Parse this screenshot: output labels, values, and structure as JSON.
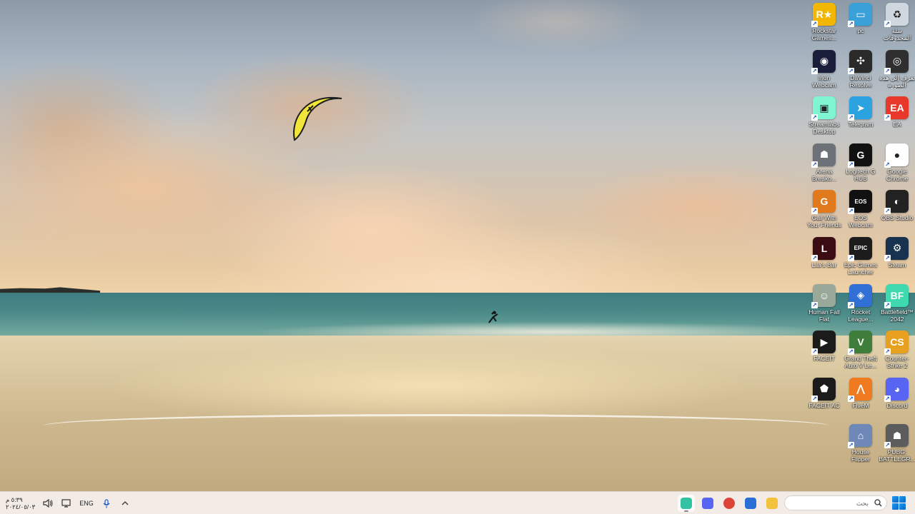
{
  "desktop_icons": [
    {
      "label": "Rockstar Games...",
      "icon": "rockstar-games-icon",
      "color": "#f2b705",
      "glyph": "R★"
    },
    {
      "label": "pc",
      "icon": "this-pc-icon",
      "color": "#3aa0d8",
      "glyph": "▭"
    },
    {
      "label": "سلة المحذوفات",
      "icon": "recycle-bin-icon",
      "color": "#cfd8de",
      "glyph": "♻"
    },
    {
      "label": "Iriun Webcam",
      "icon": "iriun-webcam-icon",
      "color": "#1b1e3a",
      "glyph": "◉"
    },
    {
      "label": "DaVinci Resolve",
      "icon": "davinci-resolve-icon",
      "color": "#2a2a2a",
      "glyph": "✣"
    },
    {
      "label": "تعرف إلى هذه الصورة",
      "icon": "learn-about-picture-icon",
      "color": "#2f2f2f",
      "glyph": "◎"
    },
    {
      "label": "Streamlabs Desktop",
      "icon": "streamlabs-icon",
      "color": "#80f5d2",
      "glyph": "▣"
    },
    {
      "label": "Telegram",
      "icon": "telegram-icon",
      "color": "#2aa3e0",
      "glyph": "➤"
    },
    {
      "label": "EA",
      "icon": "ea-icon",
      "color": "#e8382c",
      "glyph": "EA"
    },
    {
      "label": "Arena Breako...",
      "icon": "arena-breakout-icon",
      "color": "#6d7278",
      "glyph": "☗"
    },
    {
      "label": "Logitech G HUB",
      "icon": "logitech-g-hub-icon",
      "color": "#111111",
      "glyph": "G"
    },
    {
      "label": "Google Chrome",
      "icon": "chrome-icon",
      "color": "#ffffff",
      "glyph": "●"
    },
    {
      "label": "Gall With Your Friends",
      "icon": "golf-with-friends-icon",
      "color": "#e07a1c",
      "glyph": "G"
    },
    {
      "label": "EOS Webcam Utility Pro",
      "icon": "eos-webcam-icon",
      "color": "#111111",
      "glyph": "EOS"
    },
    {
      "label": "OBS Studio",
      "icon": "obs-studio-icon",
      "color": "#222222",
      "glyph": "◐"
    },
    {
      "label": "Lila's Bar",
      "icon": "lilas-bar-icon",
      "color": "#3b0d12",
      "glyph": "L"
    },
    {
      "label": "Epic Games Launcher",
      "icon": "epic-games-icon",
      "color": "#1c1c1c",
      "glyph": "EPIC"
    },
    {
      "label": "Steam",
      "icon": "steam-icon",
      "color": "#17324f",
      "glyph": "⚙"
    },
    {
      "label": "Human Fall Flat",
      "icon": "human-fall-flat-icon",
      "color": "#9aa89a",
      "glyph": "☺"
    },
    {
      "label": "Rocket League...",
      "icon": "rocket-league-icon",
      "color": "#2f6fd6",
      "glyph": "◈"
    },
    {
      "label": "Battlefield™ 2042",
      "icon": "battlefield-2042-icon",
      "color": "#3fd9b0",
      "glyph": "BF"
    },
    {
      "label": "FACEIT",
      "icon": "faceit-icon",
      "color": "#1b1b1b",
      "glyph": "▶"
    },
    {
      "label": "Grand Theft Auto V Le...",
      "icon": "gta-v-icon",
      "color": "#3f7d3a",
      "glyph": "V"
    },
    {
      "label": "Counter-Strike 2",
      "icon": "counter-strike-2-icon",
      "color": "#e8a020",
      "glyph": "CS"
    },
    {
      "label": "FACEIT AC",
      "icon": "faceit-ac-icon",
      "color": "#1b1b1b",
      "glyph": "⬟"
    },
    {
      "label": "FiveM",
      "icon": "fivem-icon",
      "color": "#f07a20",
      "glyph": "⋀"
    },
    {
      "label": "Discord",
      "icon": "discord-icon",
      "color": "#5865f2",
      "glyph": "◕"
    },
    {
      "label": "",
      "icon": "empty-slot",
      "color": "transparent",
      "glyph": ""
    },
    {
      "label": "House Flipper",
      "icon": "house-flipper-icon",
      "color": "#6e89b8",
      "glyph": "⌂"
    },
    {
      "label": "PUBG: BATTLEGR...",
      "icon": "pubg-icon",
      "color": "#5c5c5c",
      "glyph": "☗"
    }
  ],
  "taskbar": {
    "clock_time": "٥:٣٩ م",
    "clock_date": "٢٠٢٤/٠٥/٠٣",
    "language": "ENG",
    "search_placeholder": "بحث",
    "apps": [
      {
        "name": "Streamlabs Desktop",
        "icon": "streamlabs-taskbar-icon",
        "color": "#31c3a2",
        "active": true
      },
      {
        "name": "Discord",
        "icon": "discord-taskbar-icon",
        "color": "#5865f2",
        "active": false
      },
      {
        "name": "Google Chrome",
        "icon": "chrome-taskbar-icon",
        "color": "#db4437",
        "active": false
      },
      {
        "name": "Microsoft Store",
        "icon": "store-taskbar-icon",
        "color": "#2b6fd6",
        "active": false
      },
      {
        "name": "File Explorer",
        "icon": "file-explorer-taskbar-icon",
        "color": "#f2c23c",
        "active": false
      }
    ]
  },
  "colors": {
    "taskbar_bg": "#f3ece6",
    "accent": "#0a64c9"
  }
}
